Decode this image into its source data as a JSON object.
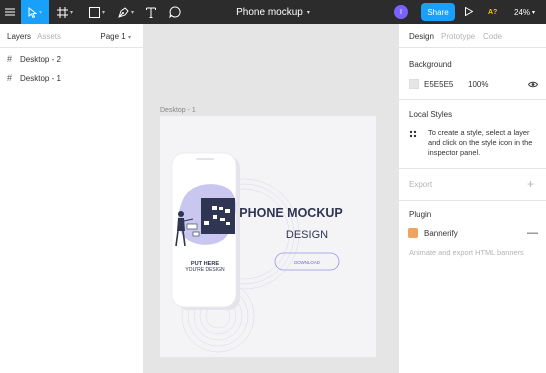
{
  "toolbar": {
    "doc_title": "Phone mockup",
    "avatar_initial": "I",
    "share_label": "Share",
    "plugin_badge": "A?",
    "zoom": "24%",
    "icons": [
      "menu-icon",
      "move-tool-icon",
      "frame-tool-icon",
      "shape-tool-icon",
      "pen-tool-icon",
      "text-tool-icon",
      "comment-tool-icon",
      "play-icon"
    ]
  },
  "left_panel": {
    "tabs": [
      "Layers",
      "Assets"
    ],
    "page_selector": "Page 1",
    "layers": [
      "Desktop - 2",
      "Desktop - 1"
    ]
  },
  "canvas": {
    "frame_label": "Desktop - 1",
    "design": {
      "headline_1": "PHONE MOCKUP",
      "headline_2": "DESIGN",
      "download_label": "DOWNLOAD",
      "phone_text_1": "PUT HERE",
      "phone_text_2": "YOU'RE DESIGN"
    }
  },
  "right_panel": {
    "tabs": [
      "Design",
      "Prototype",
      "Code"
    ],
    "background_title": "Background",
    "background_hex": "E5E5E5",
    "background_opacity": "100%",
    "local_styles_title": "Local Styles",
    "local_styles_text": "To create a style, select a layer and click on the style icon in the inspector panel.",
    "export_title": "Export",
    "plugin_title": "Plugin",
    "plugin_name": "Bannerify",
    "plugin_desc": "Animate and export HTML banners"
  },
  "colors": {
    "toolbar_bg": "#2c2c2c",
    "accent": "#18a0fb",
    "avatar": "#7b61ff",
    "canvas_bg": "#e5e5e5",
    "design_navy": "#2f3552",
    "design_lilac": "#c9c6f0"
  }
}
